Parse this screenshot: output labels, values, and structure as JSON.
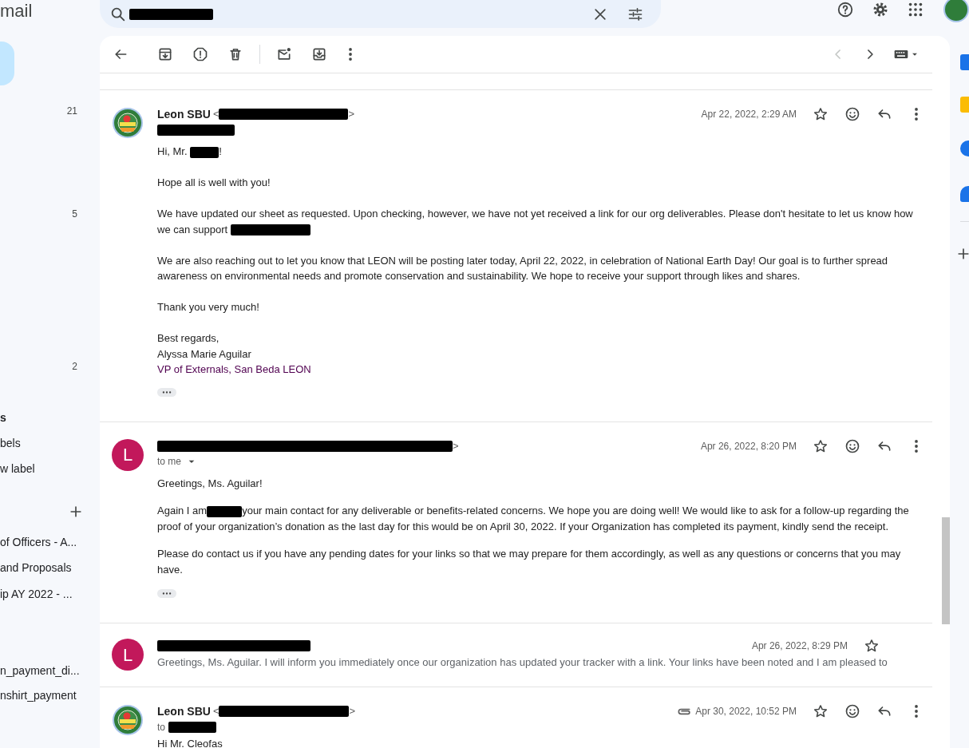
{
  "sidebar": {
    "logo": "mail",
    "items": [
      {
        "kind": "count",
        "count": "21"
      },
      {
        "kind": "count",
        "count": "5"
      },
      {
        "kind": "count",
        "count": "2"
      },
      {
        "kind": "heading",
        "label": "s"
      },
      {
        "kind": "label",
        "label": "bels"
      },
      {
        "kind": "label",
        "label": "w label"
      },
      {
        "kind": "add"
      },
      {
        "kind": "label",
        "label": "of Officers - A..."
      },
      {
        "kind": "label",
        "label": "and Proposals"
      },
      {
        "kind": "label",
        "label": "ip AY 2022 - ..."
      },
      {
        "kind": "label",
        "label": "n_payment_di..."
      },
      {
        "kind": "label",
        "label": "nshirt_payment"
      }
    ]
  },
  "search": {
    "value": [
      {
        "kind": "redacted"
      }
    ]
  },
  "pager": {
    "prev_disabled": true,
    "next_disabled": false
  },
  "messages": [
    {
      "kind": "expanded",
      "avatar": {
        "kind": "logo"
      },
      "from": [
        {
          "kind": "name",
          "text": "Leon SBU"
        },
        {
          "kind": "text",
          "text": "<"
        },
        {
          "kind": "redacted"
        },
        {
          "kind": "text",
          "text": ">"
        }
      ],
      "to": {
        "dropdown": false,
        "parts": [
          {
            "kind": "redacted"
          }
        ]
      },
      "date": "Apr 22, 2022, 2:29 AM",
      "attachment": false,
      "starred": false,
      "paragraphs": [
        {
          "lines": [
            [
              {
                "kind": "text",
                "text": "Hi, Mr. "
              },
              {
                "kind": "redacted"
              },
              {
                "kind": "text",
                "text": "!"
              }
            ]
          ]
        },
        {
          "lines": [
            [
              {
                "kind": "text",
                "text": "Hope all is well with you!"
              }
            ]
          ]
        },
        {
          "lines": [
            [
              {
                "kind": "text",
                "text": "We have updated our sheet as requested. Upon checking, however, we have not yet received a link for our org deliverables. Please don't hesitate to let us know how we can support "
              },
              {
                "kind": "redacted"
              }
            ]
          ]
        },
        {
          "lines": [
            [
              {
                "kind": "text",
                "text": "We are also reaching out to let you know that LEON will be posting later today, April 22, 2022, in celebration of National Earth Day! Our goal is to further spread awareness on environmental needs and promote conservation and sustainability. We hope to receive your support through likes and shares."
              }
            ]
          ]
        },
        {
          "lines": [
            [
              {
                "kind": "text",
                "text": "Thank you very much!"
              }
            ]
          ]
        },
        {
          "lines": [
            [
              {
                "kind": "text",
                "text": "Best regards,"
              }
            ],
            [
              {
                "kind": "text",
                "text": "Alyssa Marie Aguilar"
              }
            ],
            [
              {
                "kind": "link",
                "text": "VP of Externals, San Beda LEON"
              }
            ]
          ]
        }
      ]
    },
    {
      "kind": "expanded",
      "avatar": {
        "kind": "letter",
        "letter": "L",
        "color": "#c2185b"
      },
      "from": [
        {
          "kind": "redacted"
        },
        {
          "kind": "text",
          "text": ">"
        }
      ],
      "to": {
        "dropdown": true,
        "parts": [
          {
            "kind": "text",
            "text": "to me"
          }
        ]
      },
      "date": "Apr 26, 2022, 8:20 PM",
      "attachment": false,
      "starred": false,
      "paragraphs": [
        {
          "lines": [
            [
              {
                "kind": "text",
                "text": "Greetings, Ms. Aguilar!"
              }
            ]
          ]
        },
        {
          "lines": [
            [
              {
                "kind": "text",
                "text": "Again I am"
              },
              {
                "kind": "redacted"
              },
              {
                "kind": "text",
                "text": "your main contact for any deliverable or benefits-related concerns. We hope you are doing well! We would like to ask for a follow-up regarding the proof of your organization’s donation as the last day for this would be on April 30, 2022. If your Organization has completed its payment, kindly send the receipt."
              }
            ]
          ]
        },
        {
          "lines": [
            [
              {
                "kind": "text",
                "text": "Please do contact us if you have any pending dates for your links so that we may prepare for them accordingly, as well as any questions or concerns that you may have."
              }
            ]
          ]
        }
      ]
    },
    {
      "kind": "collapsed",
      "avatar": {
        "kind": "letter",
        "letter": "L",
        "color": "#c2185b"
      },
      "from": [
        {
          "kind": "redacted"
        }
      ],
      "date": "Apr 26, 2022, 8:29 PM",
      "attachment": false,
      "starred": false,
      "snippet": "Greetings, Ms. Aguilar. I will inform you immediately once our organization has updated your tracker with a link. Your links have been noted and I am pleased to"
    },
    {
      "kind": "expanded",
      "avatar": {
        "kind": "logo"
      },
      "from": [
        {
          "kind": "name",
          "text": "Leon SBU"
        },
        {
          "kind": "text",
          "text": "<"
        },
        {
          "kind": "redacted"
        },
        {
          "kind": "text",
          "text": ">"
        }
      ],
      "to": {
        "dropdown": false,
        "parts": [
          {
            "kind": "text",
            "text": "to"
          },
          {
            "kind": "redacted"
          }
        ]
      },
      "date": "Apr 30, 2022, 10:52 PM",
      "attachment": true,
      "starred": false,
      "paragraphs": [
        {
          "lines": [
            [
              {
                "kind": "text",
                "text": "Hi Mr. Cleofas"
              }
            ]
          ]
        }
      ]
    }
  ]
}
